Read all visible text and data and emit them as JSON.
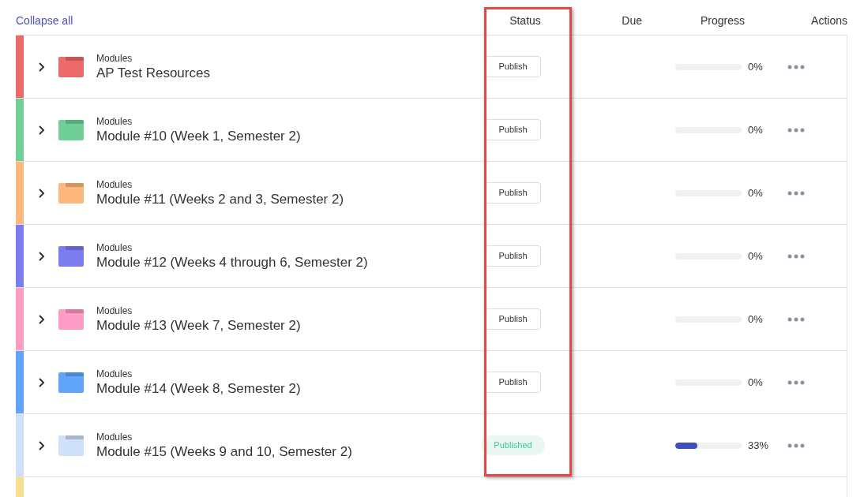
{
  "collapse_link": "Collapse all",
  "columns": {
    "status": "Status",
    "due": "Due",
    "progress": "Progress",
    "actions": "Actions"
  },
  "rows": [
    {
      "color": "#ec6a6a",
      "category": "Modules",
      "title": "AP Test Resources",
      "status": {
        "label": "Publish",
        "published": false
      },
      "progress": {
        "level": 0,
        "reading": "0%"
      }
    },
    {
      "color": "#6fcf97",
      "category": "Modules",
      "title": "Module #10 (Week 1, Semester 2)",
      "status": {
        "label": "Publish",
        "published": false
      },
      "progress": {
        "level": 0,
        "reading": "0%"
      }
    },
    {
      "color": "#fdb97d",
      "category": "Modules",
      "title": "Module #11 (Weeks 2 and 3, Semester 2)",
      "status": {
        "label": "Publish",
        "published": false
      },
      "progress": {
        "level": 0,
        "reading": "0%"
      }
    },
    {
      "color": "#7b7cf0",
      "category": "Modules",
      "title": "Module #12 (Weeks 4 through 6, Semester 2)",
      "status": {
        "label": "Publish",
        "published": false
      },
      "progress": {
        "level": 0,
        "reading": "0%"
      }
    },
    {
      "color": "#ff9cc3",
      "category": "Modules",
      "title": "Module #13 (Week 7, Semester 2)",
      "status": {
        "label": "Publish",
        "published": false
      },
      "progress": {
        "level": 0,
        "reading": "0%"
      }
    },
    {
      "color": "#60a5fa",
      "category": "Modules",
      "title": "Module #14 (Week 8, Semester 2)",
      "status": {
        "label": "Publish",
        "published": false
      },
      "progress": {
        "level": 0,
        "reading": "0%"
      }
    },
    {
      "color": "#cfe0fb",
      "category": "Modules",
      "title": "Module #15 (Weeks 9 and 10, Semester 2)",
      "status": {
        "label": "Published",
        "published": true
      },
      "progress": {
        "level": 0.33,
        "reading": "33%"
      }
    }
  ],
  "partial_row": {
    "color": "#f8df8f"
  }
}
